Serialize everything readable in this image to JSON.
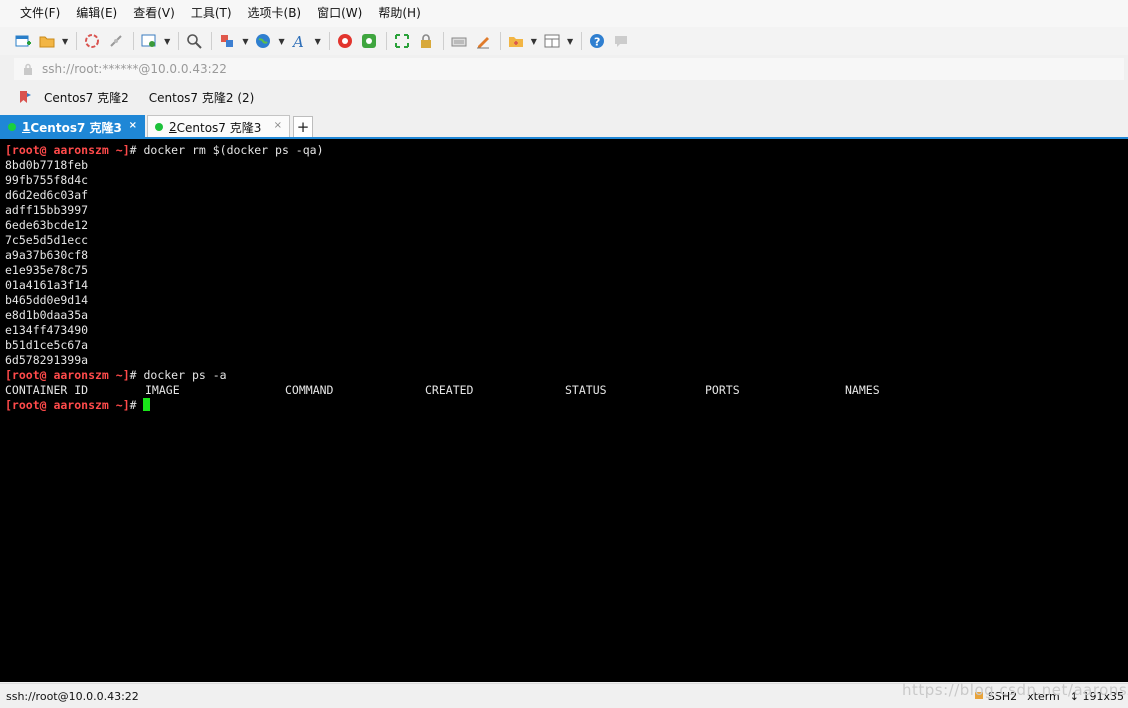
{
  "colors": {
    "accent": "#1f87d6",
    "prompt": "#ff4a4a",
    "cursor": "#19e619",
    "terminal_bg": "#000000"
  },
  "menu": [
    "文件(F)",
    "编辑(E)",
    "查看(V)",
    "工具(T)",
    "选项卡(B)",
    "窗口(W)",
    "帮助(H)"
  ],
  "toolbar_icons": [
    "new-session-icon",
    "open-folder-icon",
    "reconnect-icon",
    "disconnect-icon",
    "session-properties-icon",
    "search-icon",
    "transfer-icon",
    "globe-icon",
    "font-icon",
    "xftp-icon",
    "xshell-icon",
    "fullscreen-icon",
    "lock-icon",
    "keyboard-icon",
    "compose-icon",
    "new-tab-icon",
    "layout-icon",
    "help-icon",
    "chat-icon"
  ],
  "address": "ssh://root:******@10.0.0.43:22",
  "links": [
    "Centos7 克隆2",
    "Centos7 克隆2 (2)"
  ],
  "tabs": [
    {
      "num": "1",
      "label": " Centos7 克隆3",
      "close": "×"
    },
    {
      "num": "2",
      "label": " Centos7 克隆3",
      "close": "×"
    }
  ],
  "add_tab": "+",
  "terminal": {
    "prompt": "[root@ aaronszm ~]",
    "hash": "# ",
    "cmd1": "docker rm $(docker ps -qa)",
    "ids": [
      "8bd0b7718feb",
      "99fb755f8d4c",
      "d6d2ed6c03af",
      "adff15bb3997",
      "6ede63bcde12",
      "7c5e5d5d1ecc",
      "a9a37b630cf8",
      "e1e935e78c75",
      "01a4161a3f14",
      "b465dd0e9d14",
      "e8d1b0daa35a",
      "e134ff473490",
      "b51d1ce5c67a",
      "6d578291399a"
    ],
    "cmd2": "docker ps -a",
    "headers": [
      "CONTAINER ID",
      "IMAGE",
      "COMMAND",
      "CREATED",
      "STATUS",
      "PORTS",
      "NAMES"
    ]
  },
  "status": {
    "left": "ssh://root@10.0.0.43:22",
    "protocol": "SSH2",
    "term": "xterm",
    "size": "191x35",
    "watermark": "https://blog.csdn.net/aaronszm"
  }
}
